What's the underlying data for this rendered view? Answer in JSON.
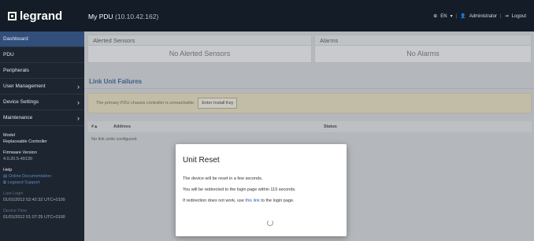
{
  "header": {
    "brand": "legrand",
    "pdu_name": "My PDU",
    "pdu_ip": "(10.10.42.162)",
    "language": "EN",
    "user": "Administrator",
    "logout": "Logout"
  },
  "sidebar": {
    "items": [
      {
        "label": "Dashboard"
      },
      {
        "label": "PDU"
      },
      {
        "label": "Peripherals"
      },
      {
        "label": "User Management",
        "chevron": "›"
      },
      {
        "label": "Device Settings",
        "chevron": "›"
      },
      {
        "label": "Maintenance",
        "chevron": "›"
      }
    ],
    "model_label": "Model",
    "model_value": "Replaceable Controller",
    "firmware_label": "Firmware Version",
    "firmware_value": "4.0.20.5-49130",
    "help_label": "Help",
    "online_docs": "Online Documentation",
    "support": "Legrand Support",
    "last_login_label": "Last Login",
    "last_login_value": "01/01/2012 02:42:32 UTC+0100",
    "device_time_label": "Device Time",
    "device_time_value": "01/01/2012 01:07:25 UTC+0100"
  },
  "main": {
    "alerted_sensors": {
      "title": "Alerted Sensors",
      "body": "No Alerted Sensors"
    },
    "alarms": {
      "title": "Alarms",
      "body": "No Alarms"
    },
    "link_unit_failures": {
      "title": "Link Unit Failures",
      "warning": "The primary PDU chassis controller is unreachable.",
      "button": "Enter Install Key",
      "columns": [
        "#▲",
        "Address",
        "Status"
      ],
      "empty": "No link units configured."
    }
  },
  "modal": {
    "title": "Unit Reset",
    "line1": "The device will be reset in a few seconds.",
    "line2": "You will be redirected to the login page within 119 seconds.",
    "line3_pre": "If redirection does not work, use ",
    "line3_link": "this link",
    "line3_post": " to the login page."
  },
  "icons": {
    "globe": "globe-icon",
    "user": "user-icon",
    "logout": "logout-icon",
    "spinner": "spinner-icon"
  }
}
